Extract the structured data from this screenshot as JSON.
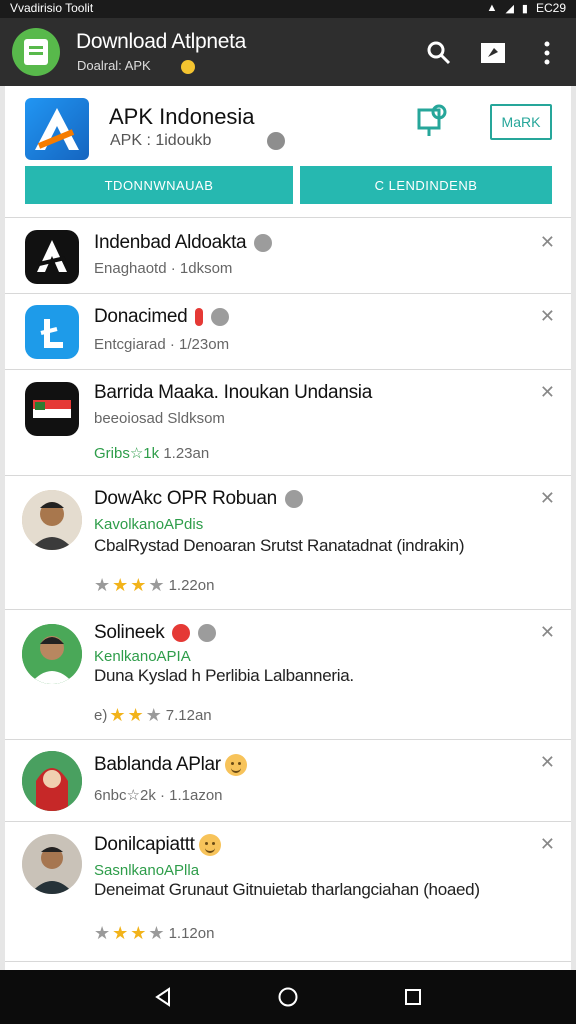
{
  "status_bar": {
    "left_text": "Vvadirisio Toolit",
    "time": "EC29"
  },
  "app_bar": {
    "title": "Download Atlpneta",
    "subtitle": "Doalral: APK"
  },
  "header_card": {
    "title": "APK Indonesia",
    "subtitle": "APK : 1idoukb",
    "mark_label": "MaRK",
    "button_left": "TDONNWNAUAB",
    "button_right": "C   LENDINDENB"
  },
  "items": [
    {
      "name": "Indenbad Aldoakta",
      "meta": "Enaghaotd · 1dksom",
      "icon": "a-logo-icon"
    },
    {
      "name": "Donacimed",
      "meta": "Entcgiarad · 1/23om",
      "icon": "blue-l-icon"
    },
    {
      "name": "Barrida Maaka. Inoukan Undansia",
      "meta": "beeoiosad Sldksom",
      "green": "Gribs☆1k",
      "date": "1.23an",
      "icon": "flag-app-icon"
    },
    {
      "name": "DowAkc OPR Robuan",
      "green": "KavolkanoAPdis",
      "desc": "CbalRystad Denoaran Srutst Ranatadnat (indrakin)",
      "rating_date": "1.22on",
      "stars": 3
    },
    {
      "name": "Solineek",
      "green": "KenlkanoAPIA",
      "desc": "Duna Kyslad h Perlibia Lalbanneria.",
      "rating_prefix": "e)",
      "rating_date": "7.12an",
      "stars": 2
    },
    {
      "name": "Bablanda APlar",
      "meta": "6nbc☆2k · 1.1azon"
    },
    {
      "name": "Donilcapiattt",
      "green": "SasnlkanoAPlla",
      "desc": "Deneimat Grunaut Gitnuietab tharlangciahan (hoaed)",
      "rating_date": "1.12on",
      "stars": 3
    }
  ],
  "colors": {
    "accent": "#26b8b0",
    "green_text": "#2e9d4a",
    "star": "#f2b31a",
    "appbar": "#2e2e2e"
  }
}
